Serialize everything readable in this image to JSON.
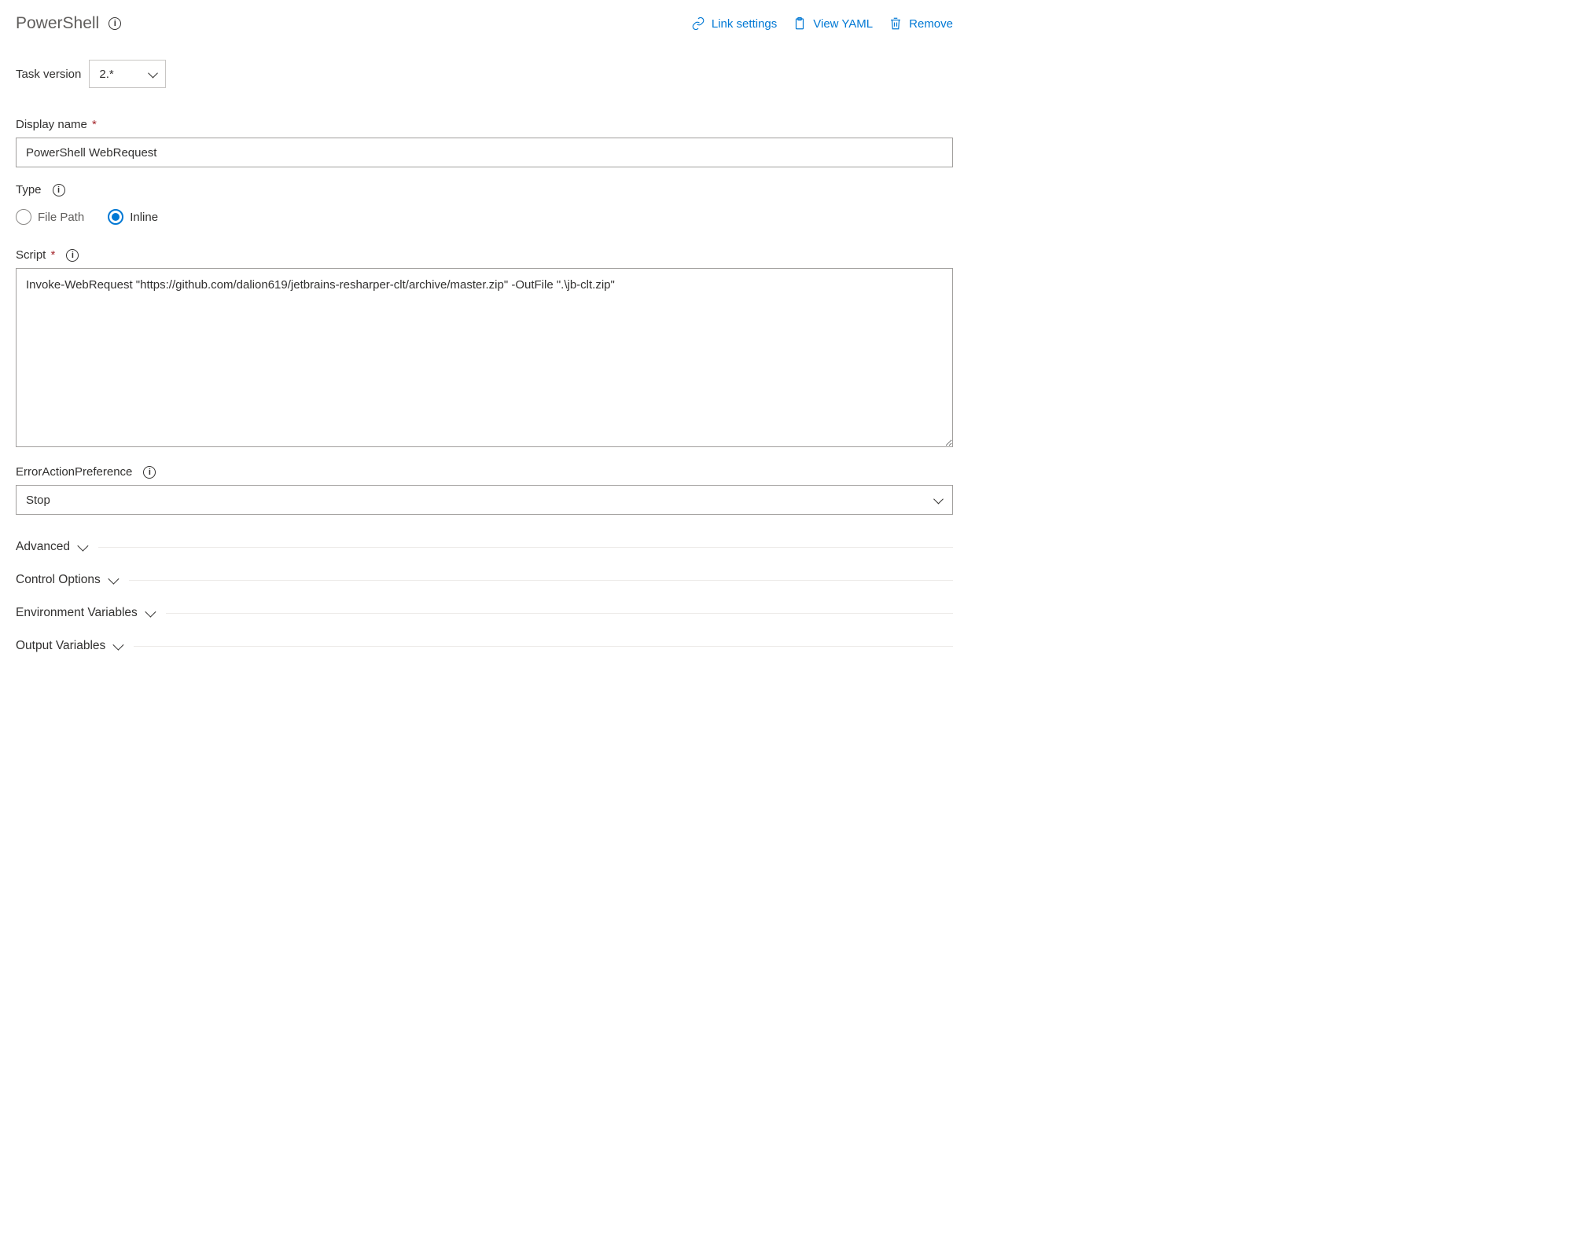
{
  "header": {
    "title": "PowerShell",
    "actions": {
      "link_settings": "Link settings",
      "view_yaml": "View YAML",
      "remove": "Remove"
    }
  },
  "task_version": {
    "label": "Task version",
    "value": "2.*"
  },
  "display_name": {
    "label": "Display name",
    "value": "PowerShell WebRequest"
  },
  "type": {
    "label": "Type",
    "options": {
      "file_path": "File Path",
      "inline": "Inline"
    },
    "selected": "inline"
  },
  "script": {
    "label": "Script",
    "value": "Invoke-WebRequest \"https://github.com/dalion619/jetbrains-resharper-clt/archive/master.zip\" -OutFile \".\\jb-clt.zip\""
  },
  "error_action": {
    "label": "ErrorActionPreference",
    "value": "Stop"
  },
  "sections": {
    "advanced": "Advanced",
    "control_options": "Control Options",
    "env_vars": "Environment Variables",
    "output_vars": "Output Variables"
  }
}
